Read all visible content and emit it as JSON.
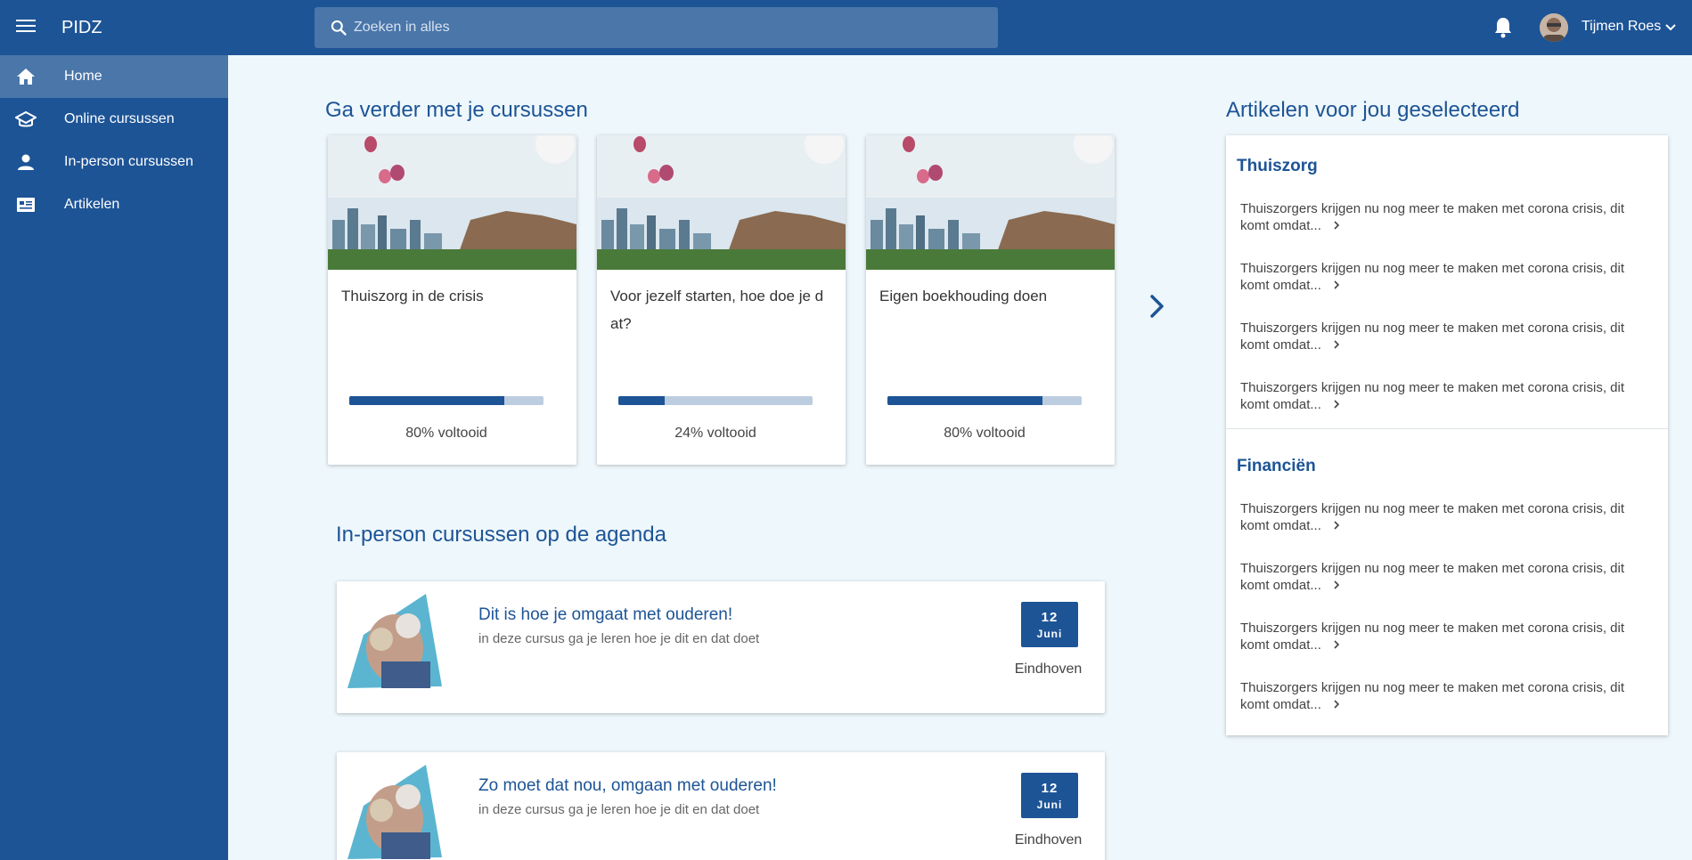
{
  "app": {
    "brand": "PIDZ"
  },
  "search": {
    "placeholder": "Zoeken in alles"
  },
  "user": {
    "name": "Tijmen Roes"
  },
  "sidebar": {
    "items": [
      {
        "label": "Home",
        "icon": "home-icon",
        "active": true
      },
      {
        "label": "Online cursussen",
        "icon": "graduation-cap-icon",
        "active": false
      },
      {
        "label": "In-person cursussen",
        "icon": "person-icon",
        "active": false
      },
      {
        "label": "Artikelen",
        "icon": "article-icon",
        "active": false
      }
    ]
  },
  "courses": {
    "heading": "Ga verder met je cursussen",
    "items": [
      {
        "title": "Thuiszorg in de crisis",
        "progress": 80,
        "progress_label": "80% voltooid"
      },
      {
        "title": "Voor jezelf starten, hoe doe je d at?",
        "progress": 24,
        "progress_label": "24% voltooid"
      },
      {
        "title": "Eigen boekhouding doen",
        "progress": 80,
        "progress_label": "80% voltooid"
      }
    ]
  },
  "events": {
    "heading": "In-person cursussen op de agenda",
    "items": [
      {
        "title": "Dit is hoe je omgaat met ouderen!",
        "description": "in deze cursus ga je leren hoe je dit en dat doet",
        "day": "12",
        "month": "Juni",
        "location": "Eindhoven"
      },
      {
        "title": "Zo moet dat nou, omgaan met ouderen!",
        "description": "in deze cursus ga je leren hoe je dit en dat doet",
        "day": "12",
        "month": "Juni",
        "location": "Eindhoven"
      }
    ]
  },
  "articles": {
    "heading": "Artikelen voor jou geselecteerd",
    "sections": [
      {
        "title": "Thuiszorg",
        "items": [
          "Thuiszorgers krijgen nu nog meer te maken met corona crisis, dit komt omdat...",
          "Thuiszorgers krijgen nu nog meer te maken met corona crisis, dit komt omdat...",
          "Thuiszorgers krijgen nu nog meer te maken met corona crisis, dit komt omdat...",
          "Thuiszorgers krijgen nu nog meer te maken met corona crisis, dit komt omdat..."
        ]
      },
      {
        "title": "Financiën",
        "items": [
          "Thuiszorgers krijgen nu nog meer te maken met corona crisis, dit komt omdat...",
          "Thuiszorgers krijgen nu nog meer te maken met corona crisis, dit komt omdat...",
          "Thuiszorgers krijgen nu nog meer te maken met corona crisis, dit komt omdat...",
          "Thuiszorgers krijgen nu nog meer te maken met corona crisis, dit komt omdat..."
        ]
      }
    ]
  },
  "colors": {
    "primary": "#1d5496",
    "primary_light": "#4a76aa",
    "background": "#eef7fb",
    "progress_track": "#bccde0"
  }
}
